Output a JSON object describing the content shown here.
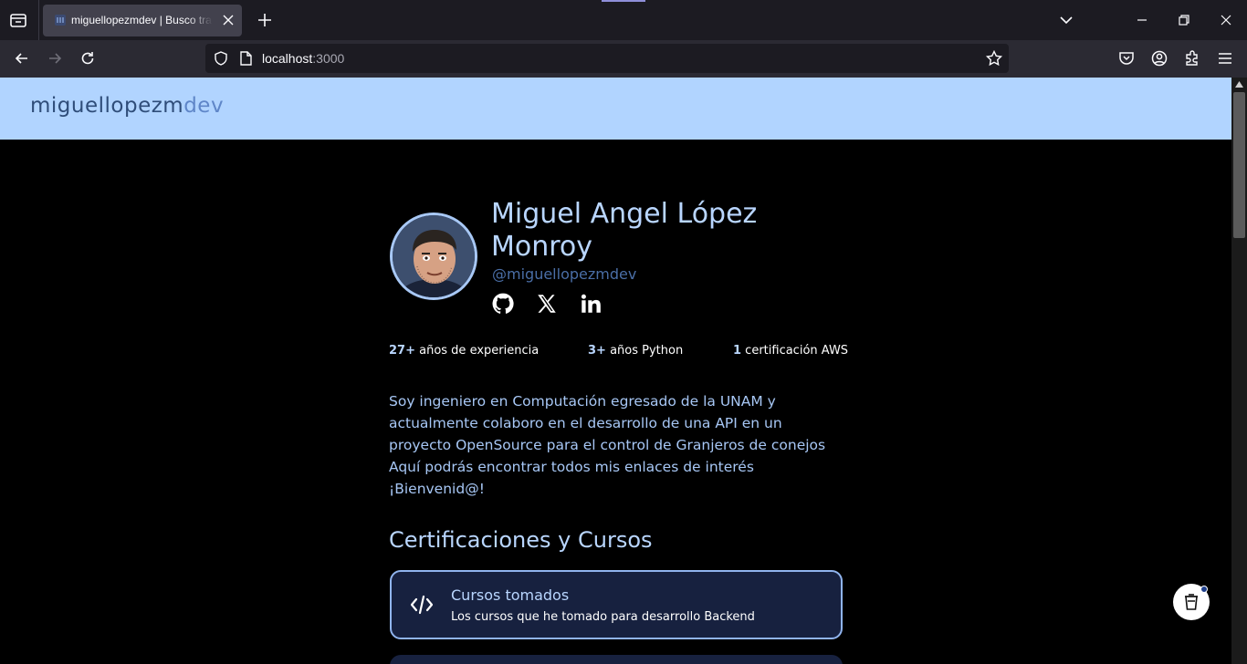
{
  "browser": {
    "tab_title": "miguellopezmdev | Busco trabajo",
    "url_host": "localhost",
    "url_port": ":3000"
  },
  "site": {
    "logo_main": "miguellopezm",
    "logo_accent": "dev"
  },
  "profile": {
    "name": "Miguel Angel López Monroy",
    "handle": "@miguellopezmdev",
    "social_icons": [
      "github-icon",
      "x-twitter-icon",
      "linkedin-icon"
    ]
  },
  "stats": [
    {
      "value": "27+",
      "label": " años de experiencia"
    },
    {
      "value": "3+",
      "label": " años Python"
    },
    {
      "value": "1",
      "label": " certificación AWS"
    }
  ],
  "bio": {
    "lines": [
      "Soy ingeniero en Computación egresado de la UNAM y",
      "actualmente colaboro en el desarrollo de una API en un",
      "proyecto OpenSource para el control de Granjeros de conejos",
      "Aquí podrás encontrar todos mis enlaces de interés",
      "¡Bienvenid@!"
    ]
  },
  "section": {
    "title": "Certificaciones y Cursos",
    "cards": [
      {
        "icon": "code-icon",
        "title": "Cursos tomados",
        "description": "Los cursos que he tomado para desarrollo Backend"
      }
    ]
  },
  "colors": {
    "header_bg": "#b1d4ff",
    "accent": "#b9d6ff",
    "card_bg": "#17213f",
    "card_border": "#90b4ee"
  }
}
